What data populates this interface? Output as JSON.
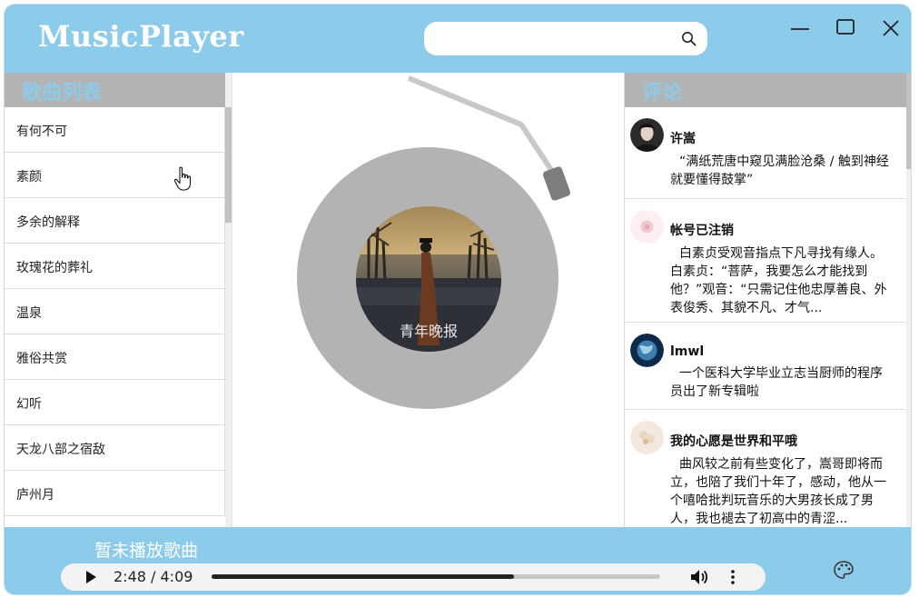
{
  "app": {
    "title": "MusicPlayer",
    "search_value": "",
    "search_placeholder": ""
  },
  "song_list": {
    "header": "歌曲列表",
    "items": [
      "有何不可",
      "素颜",
      "多余的解释",
      "玫瑰花的葬礼",
      "温泉",
      "雅俗共赏",
      "幻听",
      "天龙八部之宿敌",
      "庐州月"
    ]
  },
  "album": {
    "cover_text": "青年晚报",
    "disc_color": "#b3b3b3"
  },
  "comments": {
    "header": "评论",
    "items": [
      {
        "user": "许嵩",
        "text": "“满纸荒唐中窥见满脸沧桑 / 触到神经就要懂得鼓掌”",
        "avatar": "dark-portrait"
      },
      {
        "user": "帐号已注销",
        "text": "白素贞受观音指点下凡寻找有缘人。白素贞：“菩萨，我要怎么才能找到他？”观音：“只需记住他忠厚善良、外表俊秀、其貌不凡、才气...",
        "avatar": "pink-flower"
      },
      {
        "user": "lmwl",
        "text": "一个医科大学毕业立志当厨师的程序员出了新专辑啦",
        "avatar": "blue-earth"
      },
      {
        "user": "我的心愿是世界和平哦",
        "text": "曲风较之前有些变化了，嵩哥即将而立，也陪了我们十年了，感动，他从一个嘻哈批判玩音乐的大男孩长成了男人，我也褪去了初高中的青涩...",
        "avatar": "cream-flower"
      }
    ]
  },
  "player": {
    "now_playing": "暂未播放歌曲",
    "time": "2:48 / 4:09",
    "progress_fraction": 0.674
  },
  "colors": {
    "accent": "#8ccbea",
    "panel_header": "#b3b3b3"
  },
  "icons": [
    "search-icon",
    "minimize-icon",
    "maximize-icon",
    "close-icon",
    "play-icon",
    "volume-icon",
    "more-vertical-icon",
    "palette-icon",
    "hand-cursor-icon"
  ]
}
